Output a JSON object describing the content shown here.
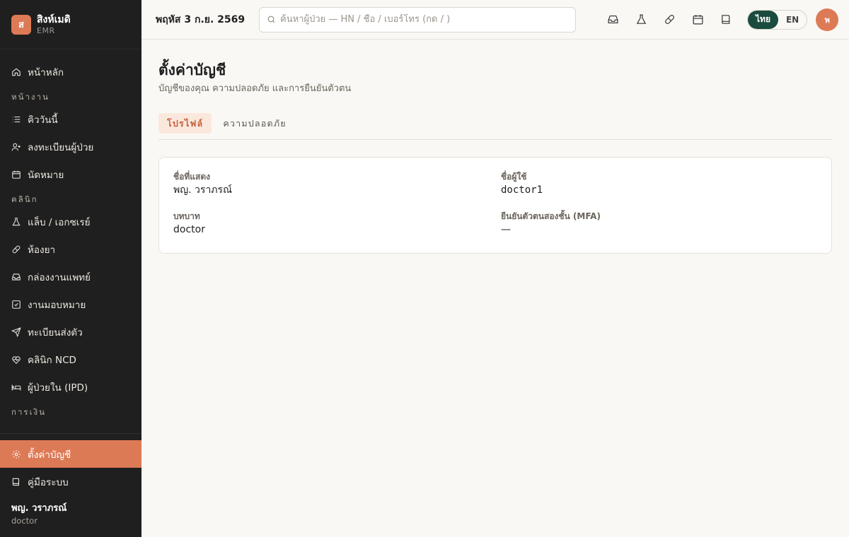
{
  "brand": {
    "logo_letter": "ส",
    "name": "สิงห์เมดิ",
    "sub": "EMR"
  },
  "sidebar": {
    "home": "หน้าหลัก",
    "section_work": "หน้างาน",
    "work_items": [
      "คิววันนี้",
      "ลงทะเบียนผู้ป่วย",
      "นัดหมาย"
    ],
    "section_clinic": "คลินิก",
    "clinic_items": [
      "แล็บ / เอกซเรย์",
      "ห้องยา",
      "กล่องงานแพทย์",
      "งานมอบหมาย",
      "ทะเบียนส่งตัว",
      "คลินิก NCD",
      "ผู้ป่วยใน (IPD)"
    ],
    "section_finance": "การเงิน",
    "settings": "ตั้งค่าบัญชี",
    "manual": "คู่มือระบบ",
    "user_name": "พญ. วราภรณ์",
    "user_role": "doctor"
  },
  "header": {
    "date": "พฤหัส 3 ก.ย. 2569",
    "search_placeholder": "ค้นหาผู้ป่วย — HN / ชื่อ / เบอร์โทร (กด / )",
    "lang_th": "ไทย",
    "lang_en": "EN",
    "avatar_letter": "พ",
    "icons": [
      "inbox-icon",
      "flask-icon",
      "pill-icon",
      "calendar-icon",
      "book-icon"
    ]
  },
  "page": {
    "title": "ตั้งค่าบัญชี",
    "subtitle": "บัญชีของคุณ ความปลอดภัย และการยืนยันตัวตน",
    "tabs": [
      "โปรไฟล์",
      "ความปลอดภัย"
    ]
  },
  "profile": {
    "display_name_label": "ชื่อที่แสดง",
    "display_name_value": "พญ. วราภรณ์",
    "username_label": "ชื่อผู้ใช้",
    "username_value": "doctor1",
    "role_label": "บทบาท",
    "role_value": "doctor",
    "mfa_label": "ยืนยันตัวตนสองชั้น (MFA)",
    "mfa_value": "—"
  },
  "colors": {
    "accent": "#dd7a56",
    "sidebar_bg": "#1f1f1f",
    "lang_active": "#1a4b3e"
  }
}
